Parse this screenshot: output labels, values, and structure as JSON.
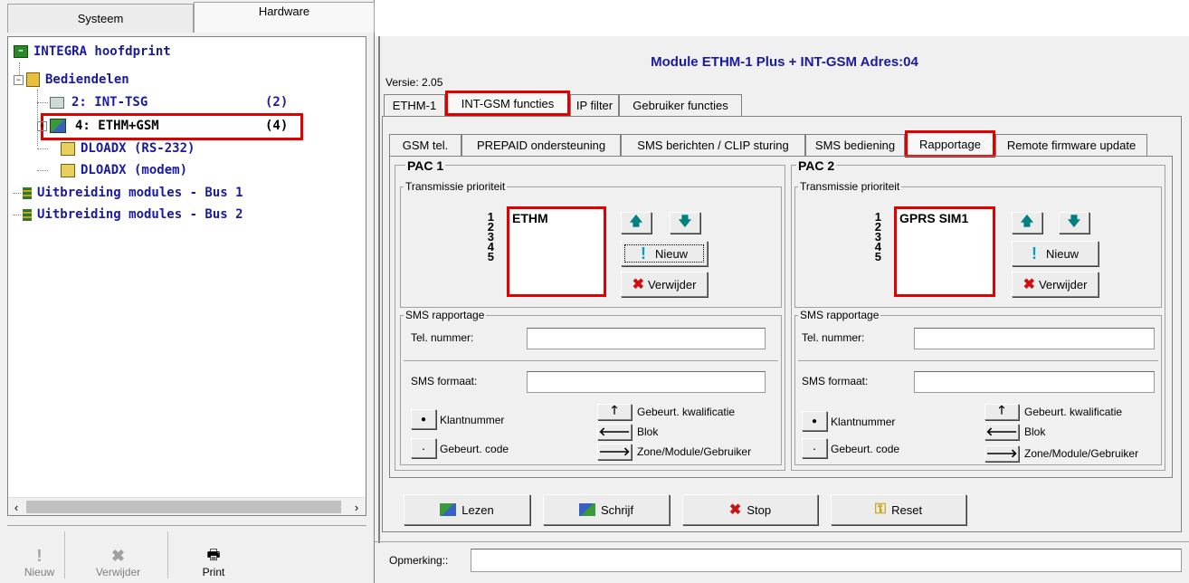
{
  "left_tabs": [
    "Systeem",
    "Hardware"
  ],
  "tree": [
    {
      "prefix": "",
      "label": "INTEGRA hoofdprint",
      "count": "",
      "icon": "board-icon"
    },
    {
      "prefix": "⊟",
      "label": "Bediendelen",
      "count": "",
      "icon": "keypad-group-icon"
    },
    {
      "prefix": "",
      "label": "2: INT-TSG",
      "count": "(2)",
      "icon": "touch-keypad-icon"
    },
    {
      "prefix": "⊞",
      "label": "4: ETHM+GSM",
      "count": "(4)",
      "icon": "ethernet-module-icon"
    },
    {
      "prefix": "",
      "label": "DLOADX (RS-232)",
      "count": "",
      "icon": "computer-icon"
    },
    {
      "prefix": "",
      "label": "DLOADX (modem)",
      "count": "",
      "icon": "computer-icon"
    },
    {
      "prefix": "",
      "label": "Uitbreiding modules - Bus 1",
      "count": "",
      "icon": "expander-icon"
    },
    {
      "prefix": "",
      "label": "Uitbreiding modules - Bus 2",
      "count": "",
      "icon": "expander-icon"
    }
  ],
  "left_toolbar": {
    "new": "Nieuw",
    "delete": "Verwijder",
    "print": "Print"
  },
  "header": {
    "title": "Module ETHM-1 Plus + INT-GSM Adres:04",
    "version": "Versie: 2.05"
  },
  "main_tabs": [
    "ETHM-1",
    "INT-GSM functies",
    "IP filter",
    "Gebruiker functies"
  ],
  "sub_tabs": [
    "GSM tel.",
    "PREPAID ondersteuning",
    "SMS berichten / CLIP sturing",
    "SMS bediening",
    "Rapportage",
    "Remote firmware update"
  ],
  "pac1": {
    "title": "PAC 1",
    "priority_title": "Transmissie prioriteit",
    "priority_numbers": [
      "1",
      "2",
      "3",
      "4",
      "5"
    ],
    "priority_entries": [
      "ETHM"
    ],
    "new_label": "Nieuw",
    "delete_label": "Verwijder",
    "sms_title": "SMS rapportage",
    "tel_label": "Tel. nummer:",
    "tel_value": "",
    "format_label": "SMS formaat:",
    "format_value": "",
    "klant_label": "Klantnummer",
    "code_label": "Gebeurt. code",
    "kwal_label": "Gebeurt. kwalificatie",
    "blok_label": "Blok",
    "zone_label": "Zone/Module/Gebruiker"
  },
  "pac2": {
    "title": "PAC 2",
    "priority_title": "Transmissie prioriteit",
    "priority_numbers": [
      "1",
      "2",
      "3",
      "4",
      "5"
    ],
    "priority_entries": [
      "GPRS SIM1"
    ],
    "new_label": "Nieuw",
    "delete_label": "Verwijder",
    "sms_title": "SMS rapportage",
    "tel_label": "Tel. nummer:",
    "tel_value": "",
    "format_label": "SMS formaat:",
    "format_value": "",
    "klant_label": "Klantnummer",
    "code_label": "Gebeurt. code",
    "kwal_label": "Gebeurt. kwalificatie",
    "blok_label": "Blok",
    "zone_label": "Zone/Module/Gebruiker"
  },
  "bottom_buttons": {
    "read": "Lezen",
    "write": "Schrijf",
    "stop": "Stop",
    "reset": "Reset"
  },
  "remark": {
    "label": "Opmerking::",
    "value": ""
  },
  "colors": {
    "tree_text": "#1a1aa0",
    "title_text": "#1a1aa0",
    "highlight": "#e00000",
    "arrow": "#008080"
  }
}
